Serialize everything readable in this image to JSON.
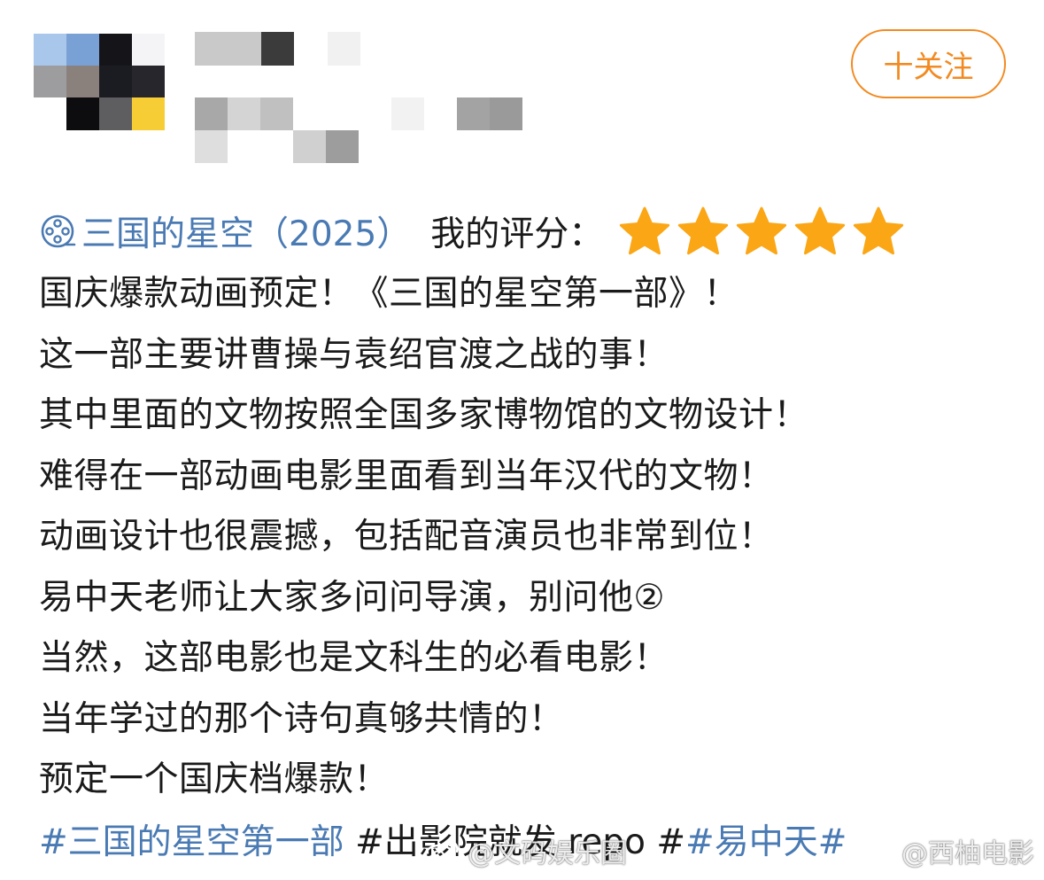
{
  "header": {
    "follow_label": "十关注"
  },
  "rating": {
    "movie_title": "三国的星空（2025）",
    "label": "我的评分：",
    "stars": 5,
    "star_color": "#fba615"
  },
  "post": {
    "lines": [
      "国庆爆款动画预定！《三国的星空第一部》！",
      "这一部主要讲曹操与袁绍官渡之战的事！",
      "其中里面的文物按照全国多家博物馆的文物设计！",
      "难得在一部动画电影里面看到当年汉代的文物！",
      "动画设计也很震撼，包括配音演员也非常到位！",
      "易中天老师让大家多问问导演，别问他②",
      "当然，这部电影也是文科生的必看电影！",
      "当年学过的那个诗句真够共情的！",
      "预定一个国庆档爆款！"
    ],
    "tag1": "#三国的星空第一部",
    "tag2_text": "#出影院就发 repo #",
    "tag3": "#易中天#"
  },
  "watermarks": {
    "left": "@文码娱乐圈",
    "right": "@西柚电影"
  },
  "colors": {
    "link": "#4a7ab3",
    "follow": "#f28a21"
  }
}
